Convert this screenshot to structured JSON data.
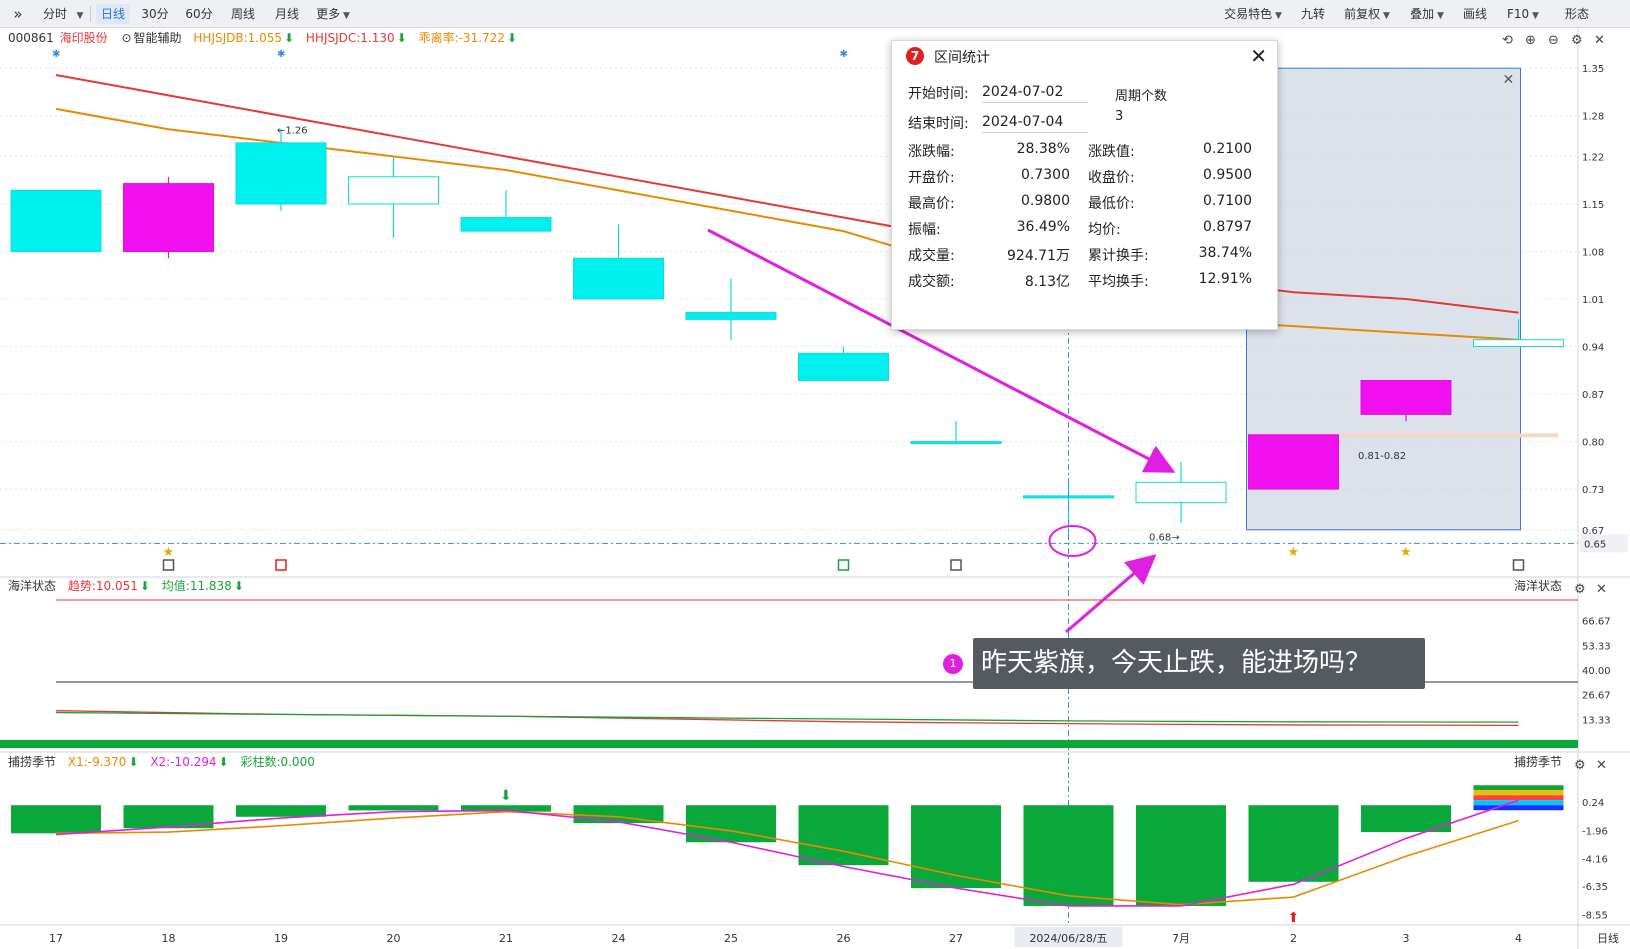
{
  "toolbar": {
    "left_items": [
      "分时",
      "日线",
      "30分",
      "60分",
      "周线",
      "月线",
      "更多"
    ],
    "active": "日线",
    "right_items": [
      "交易特色",
      "九转",
      "前复权",
      "叠加",
      "画线",
      "F10",
      "形态"
    ]
  },
  "main_legend": {
    "code": "000861",
    "name": "海印股份",
    "assist": "智能辅助",
    "ind1": "HHJSJDB:1.055",
    "ind2": "HHJSJDC:1.130",
    "ind3": "乖离率:-31.722"
  },
  "popup": {
    "title": "区间统计",
    "start_label": "开始时间:",
    "start_value": "2024-07-02",
    "end_label": "结束时间:",
    "end_value": "2024-07-04",
    "period_label": "周期个数",
    "period_value": "3",
    "rows": [
      {
        "l1": "涨跌幅:",
        "v1": "28.38%",
        "l2": "涨跌值:",
        "v2": "0.2100"
      },
      {
        "l1": "开盘价:",
        "v1": "0.7300",
        "l2": "收盘价:",
        "v2": "0.9500"
      },
      {
        "l1": "最高价:",
        "v1": "0.9800",
        "l2": "最低价:",
        "v2": "0.7100"
      },
      {
        "l1": "振幅:",
        "v1": "36.49%",
        "l2": "均价:",
        "v2": "0.8797"
      },
      {
        "l1": "成交量:",
        "v1": "924.71万",
        "l2": "累计换手:",
        "v2": "38.74%"
      },
      {
        "l1": "成交额:",
        "v1": "8.13亿",
        "l2": "平均换手:",
        "v2": "12.91%"
      }
    ]
  },
  "annotation": {
    "number": "1",
    "text": "昨天紫旗，今天止跌，能进场吗？"
  },
  "mid_panel": {
    "title": "海洋状态",
    "trend": "趋势:10.051",
    "avg": "均值:11.838",
    "right_title": "海洋状态"
  },
  "low_panel": {
    "title": "捕捞季节",
    "x1": "X1:-9.370",
    "x2": "X2:-10.294",
    "bars": "彩柱数:0.000",
    "right_title": "捕捞季节"
  },
  "chart_data": [
    {
      "type": "candlestick",
      "title": "000861 海印股份 日线",
      "x": [
        "17",
        "18",
        "19",
        "20",
        "21",
        "24",
        "25",
        "26",
        "27",
        "2024/06/28/五",
        "7月",
        "2",
        "3",
        "4"
      ],
      "y_ticks": [
        "1.35",
        "1.28",
        "1.22",
        "1.15",
        "1.08",
        "1.01",
        "0.94",
        "0.87",
        "0.80",
        "0.73",
        "0.67"
      ],
      "current_price": "0.65",
      "candles": [
        {
          "open": 1.08,
          "high": 1.15,
          "low": 1.08,
          "close": 1.17,
          "color": "cyan"
        },
        {
          "open": 1.08,
          "high": 1.19,
          "low": 1.07,
          "close": 1.18,
          "color": "magenta"
        },
        {
          "open": 1.24,
          "high": 1.26,
          "low": 1.14,
          "close": 1.15,
          "color": "cyan"
        },
        {
          "open": 1.19,
          "high": 1.22,
          "low": 1.1,
          "close": 1.15,
          "color": "hollow"
        },
        {
          "open": 1.13,
          "high": 1.17,
          "low": 1.11,
          "close": 1.11,
          "color": "cyan"
        },
        {
          "open": 1.07,
          "high": 1.12,
          "low": 1.02,
          "close": 1.01,
          "color": "cyan"
        },
        {
          "open": 0.99,
          "high": 1.04,
          "low": 0.95,
          "close": 0.98,
          "color": "cyan"
        },
        {
          "open": 0.93,
          "high": 0.94,
          "low": 0.89,
          "close": 0.89,
          "color": "cyan"
        },
        {
          "open": 0.8,
          "high": 0.83,
          "low": 0.8,
          "close": 0.8,
          "color": "cyan"
        },
        {
          "open": 0.72,
          "high": 0.74,
          "low": 0.66,
          "close": 0.72,
          "color": "cyan"
        },
        {
          "open": 0.71,
          "high": 0.77,
          "low": 0.68,
          "close": 0.74,
          "color": "hollow"
        },
        {
          "open": 0.73,
          "high": 0.81,
          "low": 0.73,
          "close": 0.81,
          "color": "magenta"
        },
        {
          "open": 0.84,
          "high": 0.89,
          "low": 0.83,
          "close": 0.89,
          "color": "magenta"
        },
        {
          "open": 0.94,
          "high": 0.98,
          "low": 0.94,
          "close": 0.95,
          "color": "hollow"
        }
      ],
      "annotations": [
        "←1.26",
        "0.68→",
        "0.81-0.82"
      ],
      "lines": [
        {
          "color": "#e53935",
          "values": [
            1.34,
            1.31,
            1.28,
            1.25,
            1.22,
            1.19,
            1.16,
            1.13,
            1.1,
            1.07,
            1.04,
            1.02,
            1.01,
            0.99
          ]
        },
        {
          "color": "#e88a00",
          "values": [
            1.29,
            1.26,
            1.24,
            1.22,
            1.2,
            1.17,
            1.14,
            1.11,
            1.06,
            1.02,
            0.98,
            0.97,
            0.96,
            0.95
          ]
        }
      ]
    },
    {
      "type": "line",
      "title": "海洋状态",
      "y_ticks": [
        "66.67",
        "53.33",
        "40.00",
        "26.67",
        "13.33"
      ],
      "series": [
        {
          "name": "趋势",
          "values": [
            18,
            17,
            16,
            15.5,
            15,
            14,
            13,
            12,
            11.5,
            11,
            10.6,
            10.3,
            10.2,
            10.051
          ]
        },
        {
          "name": "均值",
          "values": [
            17,
            16.5,
            16,
            15.5,
            15,
            14.5,
            14,
            13.5,
            13,
            12.5,
            12.2,
            12,
            11.9,
            11.838
          ]
        }
      ]
    },
    {
      "type": "bar",
      "title": "捕捞季节",
      "y_ticks": [
        "0.24",
        "-1.96",
        "-4.16",
        "-6.35",
        "-8.55"
      ],
      "values": [
        -2.2,
        -1.8,
        -0.9,
        -0.4,
        -0.5,
        -1.4,
        -2.9,
        -4.7,
        -6.5,
        -7.9,
        -7.9,
        -6.0,
        -2.1,
        0.0
      ],
      "series": [
        {
          "name": "X1",
          "values": [
            -2.2,
            -2.1,
            -1.6,
            -1.0,
            -0.5,
            -0.9,
            -2.0,
            -3.6,
            -5.5,
            -7.1,
            -7.8,
            -7.2,
            -4.0,
            -9.37
          ]
        },
        {
          "name": "X2",
          "values": [
            -2.3,
            -1.7,
            -1.0,
            -0.5,
            -0.4,
            -1.3,
            -2.9,
            -4.8,
            -6.5,
            -7.9,
            -7.9,
            -6.2,
            -2.6,
            -10.294
          ]
        }
      ]
    }
  ]
}
